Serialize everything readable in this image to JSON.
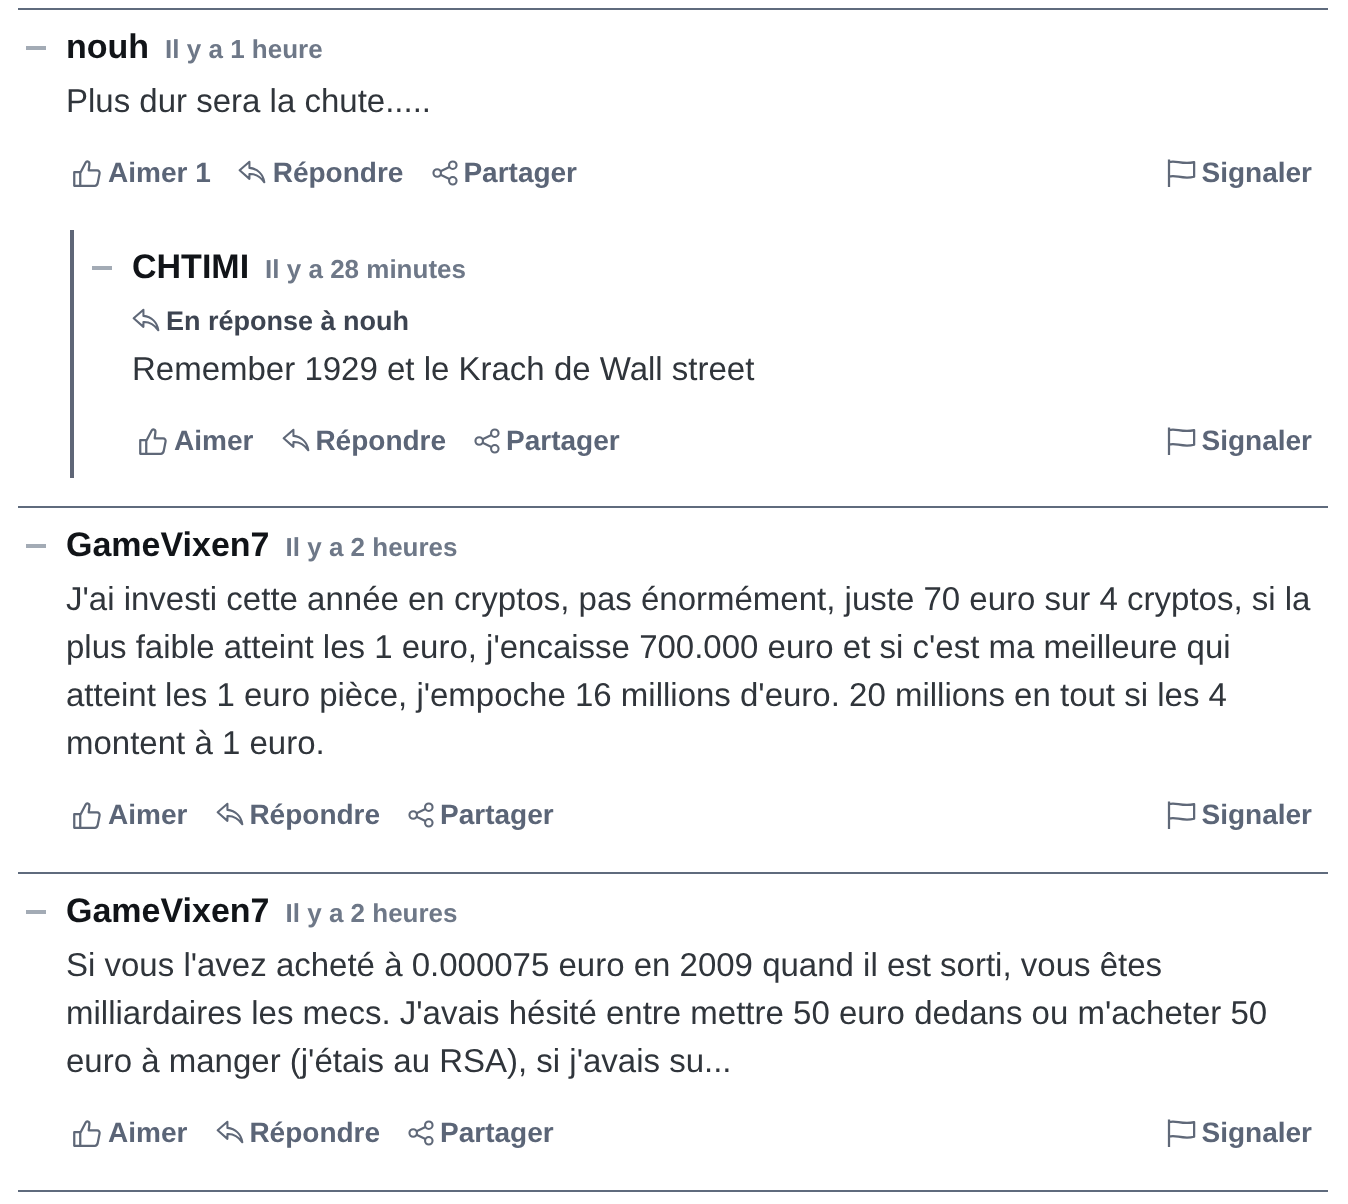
{
  "comments": [
    {
      "author": "nouh",
      "time": "Il y a 1 heure",
      "body": "Plus dur sera la chute.....",
      "actions": [
        {
          "kind": "like",
          "label": "Aimer 1"
        },
        {
          "kind": "reply",
          "label": "Répondre"
        },
        {
          "kind": "share",
          "label": "Partager"
        },
        {
          "kind": "report",
          "label": "Signaler"
        }
      ],
      "replies": [
        {
          "author": "CHTIMI",
          "time": "Il y a 28 minutes",
          "in_reply_to": "En réponse à **nouh**",
          "body": "Remember 1929 et le Krach de Wall street",
          "actions": [
            {
              "kind": "like",
              "label": "Aimer"
            },
            {
              "kind": "reply",
              "label": "Répondre"
            },
            {
              "kind": "share",
              "label": "Partager"
            },
            {
              "kind": "report",
              "label": "Signaler"
            }
          ]
        }
      ]
    },
    {
      "author": "GameVixen7",
      "time": "Il y a 2 heures",
      "body": "J'ai investi cette année en cryptos, pas énormément, juste 70 euro sur 4 cryptos, si la plus faible atteint les 1 euro, j'encaisse 700.000 euro et si c'est ma meilleure qui atteint les 1 euro pièce, j'empoche 16 millions d'euro. 20 millions en tout si les 4 montent à 1 euro.",
      "actions": [
        {
          "kind": "like",
          "label": "Aimer"
        },
        {
          "kind": "reply",
          "label": "Répondre"
        },
        {
          "kind": "share",
          "label": "Partager"
        },
        {
          "kind": "report",
          "label": "Signaler"
        }
      ]
    },
    {
      "author": "GameVixen7",
      "time": "Il y a 2 heures",
      "body": "Si vous l'avez acheté à 0.000075 euro en 2009 quand il est sorti, vous êtes milliardaires les mecs. J'avais hésité entre mettre 50 euro dedans ou m'acheter 50 euro à manger (j'étais au RSA), si j'avais su...",
      "actions": [
        {
          "kind": "like",
          "label": "Aimer"
        },
        {
          "kind": "reply",
          "label": "Répondre"
        },
        {
          "kind": "share",
          "label": "Partager"
        },
        {
          "kind": "report",
          "label": "Signaler"
        }
      ]
    }
  ]
}
